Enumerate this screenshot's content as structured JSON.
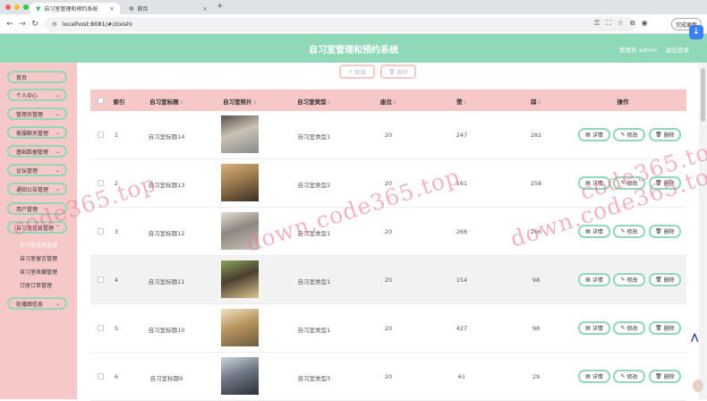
{
  "browser": {
    "tabs": [
      {
        "label": "自习室管理和预约系统"
      },
      {
        "label": "首页"
      }
    ],
    "url": "localhost:8081/#/zixishi",
    "update_label": "完成更新"
  },
  "header": {
    "title": "自习室管理和预约系统",
    "user": "管理员 admin",
    "logout": "退出登录"
  },
  "sidebar": {
    "items": [
      {
        "label": "首页"
      },
      {
        "label": "个人中心"
      },
      {
        "label": "管理员管理"
      },
      {
        "label": "客服聊天管理"
      },
      {
        "label": "基础数据管理"
      },
      {
        "label": "论坛管理"
      },
      {
        "label": "通知公告管理"
      },
      {
        "label": "用户管理"
      },
      {
        "label": "自习室信息管理"
      },
      {
        "label": "轮播图信息"
      }
    ],
    "subitems": [
      {
        "label": "自习室信息管理"
      },
      {
        "label": "自习室留言管理"
      },
      {
        "label": "自习室收藏管理"
      },
      {
        "label": "订座订单管理"
      }
    ]
  },
  "toolbar": {
    "add_label": "新增",
    "delete_label": "删除"
  },
  "table": {
    "headers": [
      "索引",
      "自习室标题",
      "自习室照片",
      "自习室类型",
      "座位",
      "赞",
      "踩",
      "操作"
    ],
    "actions": {
      "detail": "详情",
      "edit": "修改",
      "delete": "删除"
    },
    "rows": [
      {
        "index": "1",
        "title": "自习室标题14",
        "type": "自习室类型1",
        "seats": "20",
        "likes": "247",
        "dislikes": "282"
      },
      {
        "index": "2",
        "title": "自习室标题13",
        "type": "自习室类型2",
        "seats": "20",
        "likes": "161",
        "dislikes": "258"
      },
      {
        "index": "3",
        "title": "自习室标题12",
        "type": "自习室类型1",
        "seats": "20",
        "likes": "268",
        "dislikes": "266"
      },
      {
        "index": "4",
        "title": "自习室标题11",
        "type": "自习室类型1",
        "seats": "20",
        "likes": "154",
        "dislikes": "98"
      },
      {
        "index": "5",
        "title": "自习室标题10",
        "type": "自习室类型1",
        "seats": "20",
        "likes": "427",
        "dislikes": "98"
      },
      {
        "index": "6",
        "title": "自习室标题9",
        "type": "自习室类型3",
        "seats": "20",
        "likes": "61",
        "dislikes": "29"
      }
    ]
  },
  "watermarks": [
    "code365.top",
    "down.code365.top",
    "down.code365.top",
    "code365.top"
  ],
  "colors": {
    "mint": "#8fd8b8",
    "pink": "#f7c8c8"
  }
}
